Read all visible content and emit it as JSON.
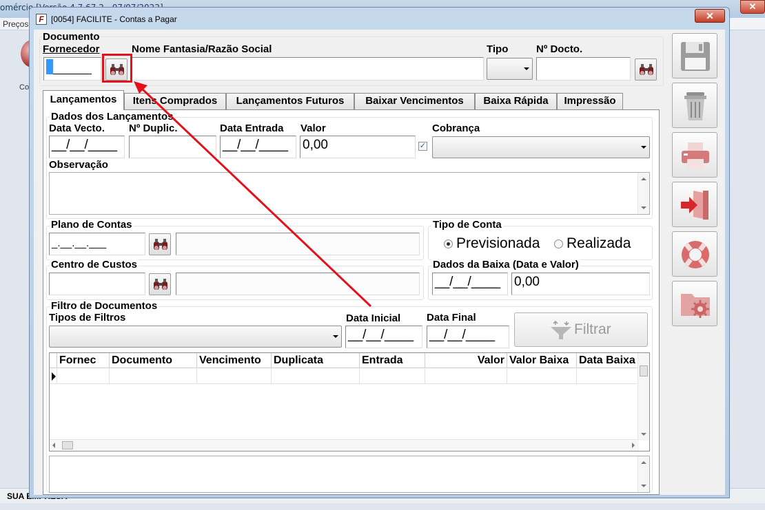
{
  "background_app": {
    "title": "omércio [Versão 4.7.67.2 - 07/07/2022]",
    "close_symbol": "✕",
    "menu_first_item": "Preços",
    "side_label": "Co",
    "status_label": "SUA EMPRESA"
  },
  "dialog": {
    "icon_letter": "F",
    "title": "[0054] FACILITE - Contas a Pagar",
    "close_symbol": "✕"
  },
  "header": {
    "documento_label": "Documento",
    "fornecedor_label": "Fornecedor",
    "fornecedor_value": "",
    "nome_label": "Nome Fantasia/Razão Social",
    "nome_value": "",
    "tipo_label": "Tipo",
    "tipo_value": "",
    "ndocto_label": "Nº Docto.",
    "ndocto_value": ""
  },
  "tabs": [
    {
      "label": "Lançamentos",
      "active": true
    },
    {
      "label": "Itens Comprados",
      "active": false
    },
    {
      "label": "Lançamentos Futuros",
      "active": false
    },
    {
      "label": "Baixar Vencimentos",
      "active": false
    },
    {
      "label": "Baixa Rápida",
      "active": false
    },
    {
      "label": "Impressão",
      "active": false
    }
  ],
  "dados": {
    "group_title": "Dados dos Lançamentos",
    "data_vecto_label": "Data Vecto.",
    "data_vecto_value": "__/__/____",
    "nduplic_label": "Nº Duplic.",
    "nduplic_value": "",
    "data_entrada_label": "Data Entrada",
    "data_entrada_value": "__/__/____",
    "valor_label": "Valor",
    "valor_value": "0,00",
    "valor_checked": true,
    "cobranca_label": "Cobrança",
    "cobranca_value": "",
    "observacao_label": "Observação"
  },
  "plano": {
    "title": "Plano de Contas",
    "code_value": "_.__.__.___",
    "desc_value": ""
  },
  "tipo_conta": {
    "title": "Tipo de Conta",
    "options": [
      "Previsionada",
      "Realizada"
    ],
    "selected": "Previsionada"
  },
  "centro": {
    "title": "Centro de Custos",
    "code_value": "",
    "desc_value": ""
  },
  "baixa": {
    "title": "Dados da Baixa (Data e Valor)",
    "date_value": "__/__/____",
    "valor_value": "0,00"
  },
  "filtro": {
    "group_title": "Filtro de Documentos",
    "tipos_label": "Tipos de Filtros",
    "tipos_value": "",
    "data_inicial_label": "Data Inicial",
    "data_inicial_value": "__/__/____",
    "data_final_label": "Data Final",
    "data_final_value": "__/__/____",
    "filtrar_label": "Filtrar"
  },
  "grid": {
    "columns": [
      "Fornec",
      "Documento",
      "Vencimento",
      "Duplicata",
      "Entrada",
      "Valor",
      "Valor Baixa",
      "Data Baixa"
    ],
    "rows": []
  },
  "toolbar": {
    "buttons": [
      "save-icon",
      "trash-icon",
      "printer-icon",
      "exit-door-icon",
      "lifebuoy-icon",
      "folder-settings-icon"
    ]
  },
  "colors": {
    "annotation_red": "#e3121a",
    "window_frame": "#b9cde2",
    "client_bg": "#f0f0f0"
  }
}
